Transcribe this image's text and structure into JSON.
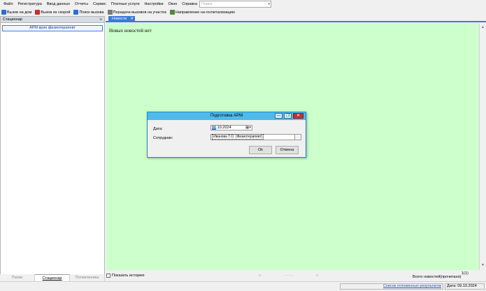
{
  "menu": {
    "items": [
      "Файл",
      "Регистратура",
      "Ввод данных",
      "Отчеты",
      "Сервис",
      "Платные услуги",
      "Настройки",
      "Окно",
      "Справка"
    ],
    "search_placeholder": "Поиск"
  },
  "toolbar": {
    "buttons": [
      {
        "label": "Вызов на дом",
        "icon": "house-call-icon",
        "color": "#2a6fcf"
      },
      {
        "label": "Вызов из скорой",
        "icon": "ambulance-icon",
        "color": "#cc2b2b"
      },
      {
        "label": "Поиск вызова",
        "icon": "search-call-icon",
        "color": "#2a6fcf"
      },
      {
        "label": "Передача вызовов на участок",
        "icon": "transfer-icon",
        "color": "#7a7a7a"
      },
      {
        "label": "Направление на госпитализацию",
        "icon": "referral-icon",
        "color": "#4a8a3a"
      }
    ]
  },
  "left_panel": {
    "title": "Стационар",
    "pin_icon": "⇲",
    "item": "АРМ врач физиотерапевт",
    "bottom_tabs": [
      "Папки",
      "Стационар",
      "Поликлиника"
    ]
  },
  "tabs": {
    "news_label": "Новости",
    "close_glyph": "✕"
  },
  "news": {
    "empty_text": "Новых новостей нет",
    "show_history_label": "Показать историю",
    "pager_prev": "«",
    "pager_mid": "- - - -",
    "pager_next": "»",
    "total_label": "Всего новостей(прочитано)",
    "page_count": "1(1)"
  },
  "status": {
    "pending_link": "Список отложенных результатов",
    "date_text": "Дата: 09.10.2024"
  },
  "dialog": {
    "title": "Подготовка АРМ",
    "date_label": "Дата:",
    "date_prefix": "09",
    "date_rest": ".10.2024",
    "employee_label": "Сотрудник:",
    "employee_value": "Иванова Т.О. (Физиотерапевт)",
    "ok_label": "Ok",
    "cancel_label": "Отмена",
    "min_glyph": "—",
    "max_glyph": "❐",
    "close_glyph": "✕"
  },
  "colors": {
    "news_bg": "#ccffcc",
    "accent": "#3a7bd5",
    "dialog_title_bg": "#4fb9ea",
    "close_btn": "#c9302c"
  }
}
